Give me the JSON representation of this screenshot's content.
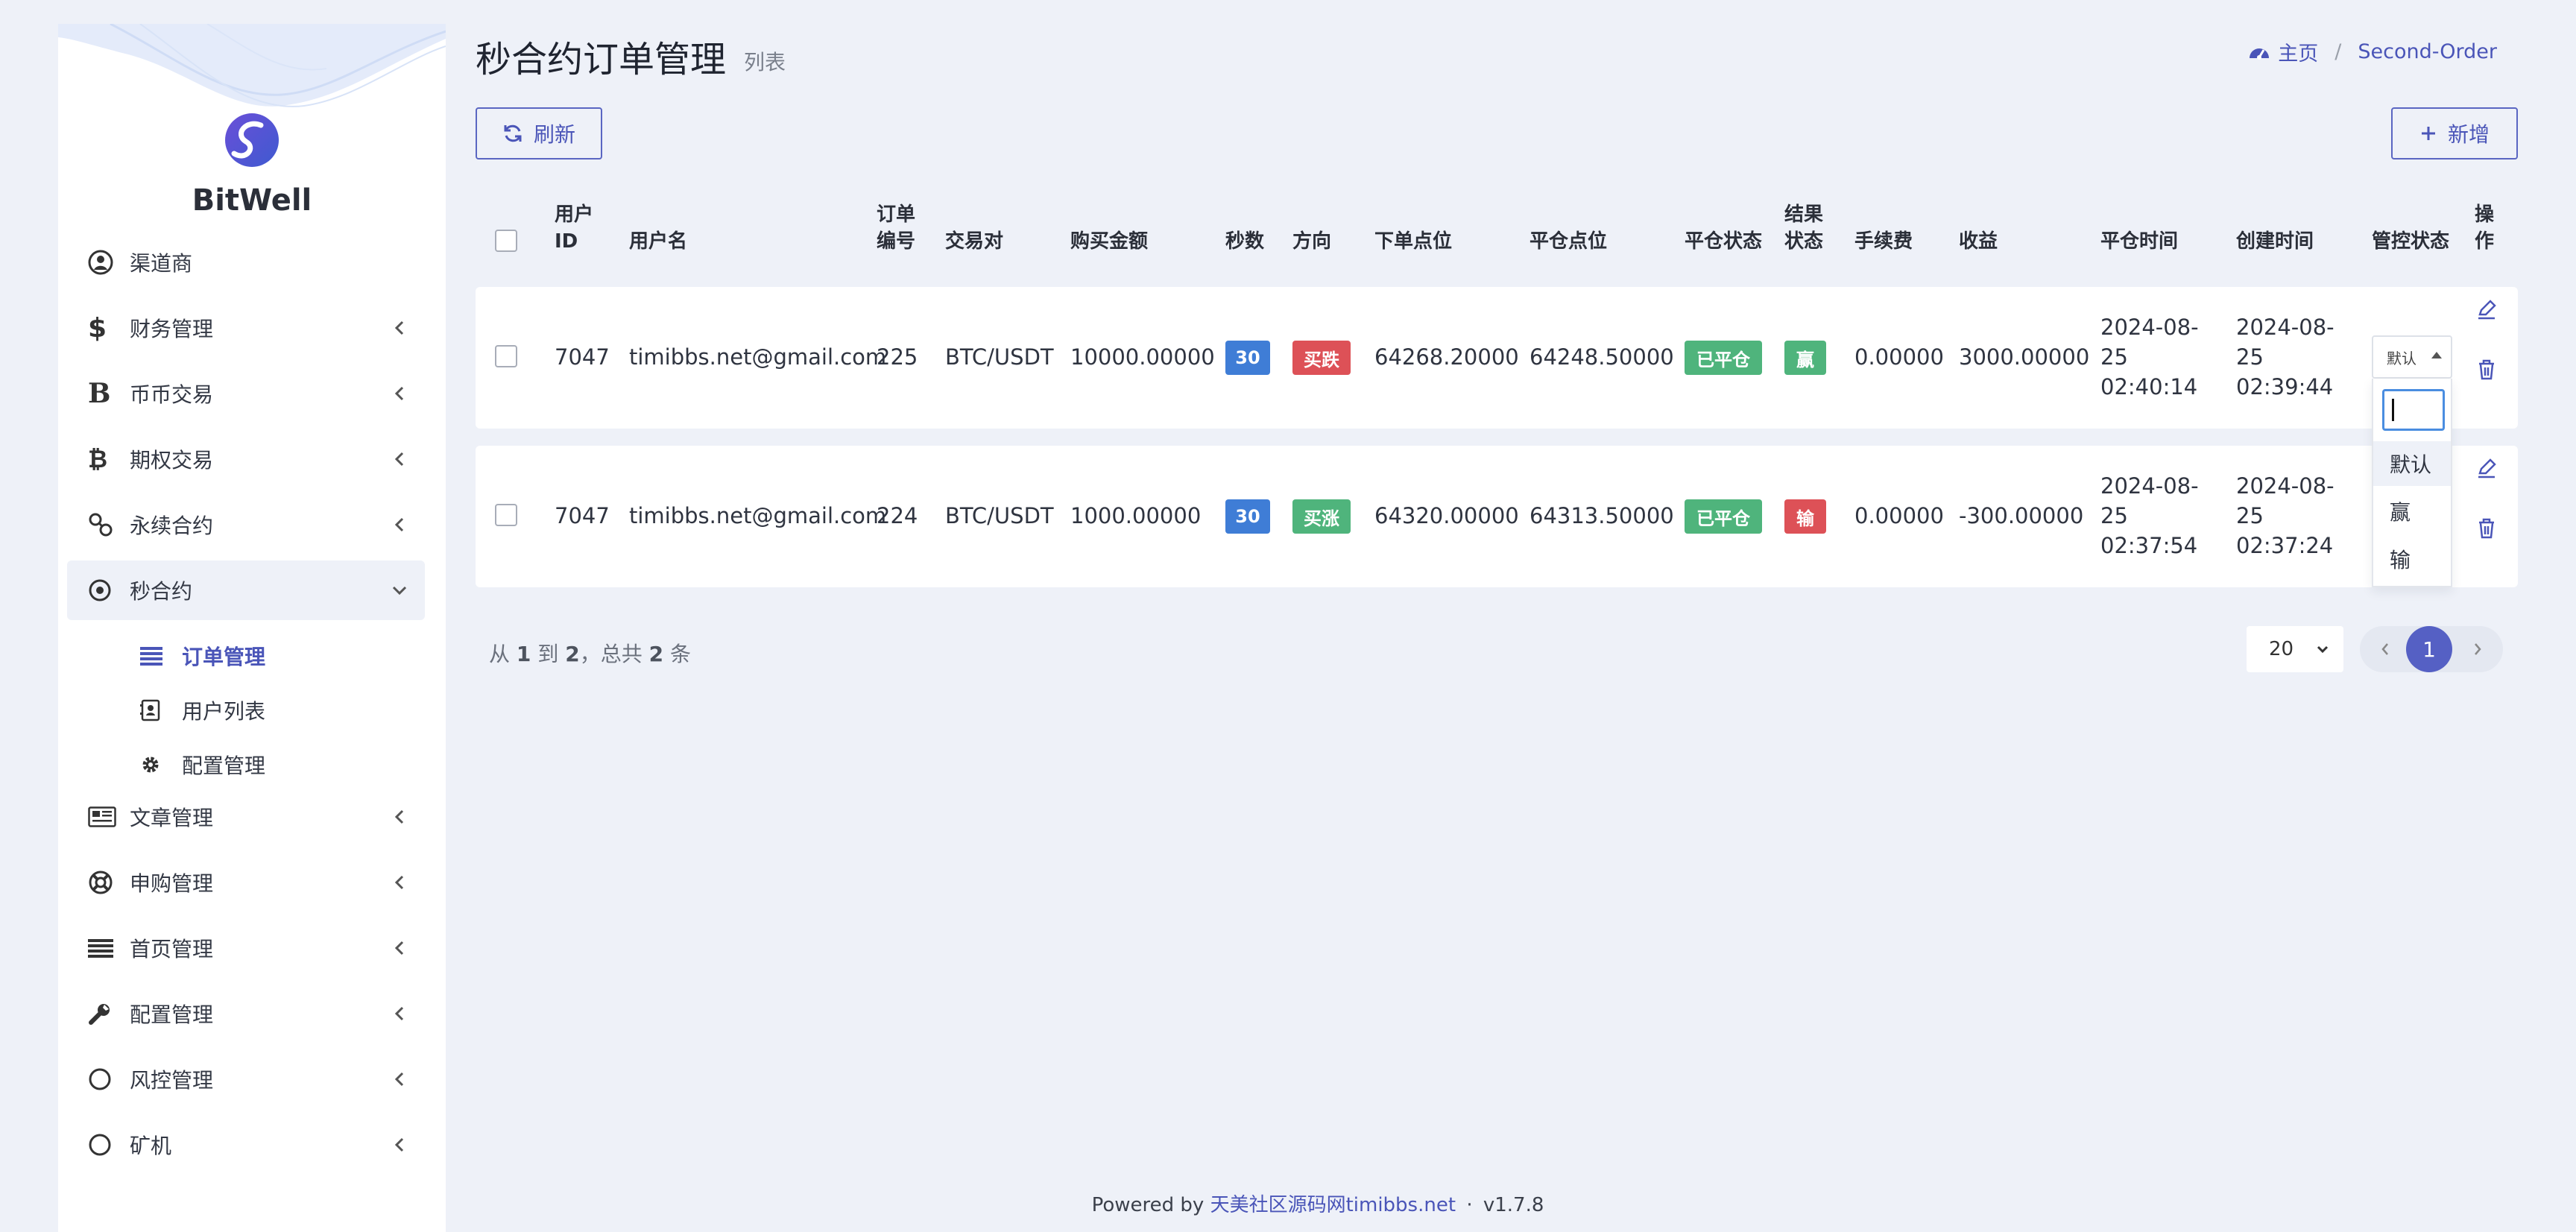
{
  "brand": {
    "name": "BitWell"
  },
  "sidebar": {
    "items": [
      {
        "label": "渠道商",
        "icon": "user-circle-icon",
        "has_children": false
      },
      {
        "label": "财务管理",
        "icon": "dollar-icon",
        "has_children": true
      },
      {
        "label": "币币交易",
        "icon": "bold-b-icon",
        "has_children": true
      },
      {
        "label": "期权交易",
        "icon": "bitcoin-icon",
        "has_children": true
      },
      {
        "label": "永续合约",
        "icon": "link-icon",
        "has_children": true
      },
      {
        "label": "秒合约",
        "icon": "dot-circle-icon",
        "has_children": true,
        "expanded": true
      },
      {
        "label": "文章管理",
        "icon": "newspaper-icon",
        "has_children": true
      },
      {
        "label": "申购管理",
        "icon": "life-ring-icon",
        "has_children": true
      },
      {
        "label": "首页管理",
        "icon": "bars-icon",
        "has_children": true
      },
      {
        "label": "配置管理",
        "icon": "wrench-icon",
        "has_children": true
      },
      {
        "label": "风控管理",
        "icon": "circle-icon",
        "has_children": true
      },
      {
        "label": "矿机",
        "icon": "circle-icon",
        "has_children": true
      }
    ],
    "subitems": [
      {
        "label": "订单管理",
        "icon": "list-icon",
        "active": true
      },
      {
        "label": "用户列表",
        "icon": "contact-icon",
        "active": false
      },
      {
        "label": "配置管理",
        "icon": "gear-icon",
        "active": false
      }
    ]
  },
  "header": {
    "title": "秒合约订单管理",
    "subtitle": "列表",
    "breadcrumb": {
      "home": "主页",
      "current": "Second-Order"
    }
  },
  "toolbar": {
    "refresh_label": "刷新",
    "add_label": "新增"
  },
  "table": {
    "columns": {
      "user_id": [
        "用户",
        "ID"
      ],
      "username": "用户名",
      "order_no": [
        "订单",
        "编号"
      ],
      "pair": "交易对",
      "amount": "购买金额",
      "seconds": "秒数",
      "direction": "方向",
      "open_price": "下单点位",
      "close_price": "平仓点位",
      "close_status": "平仓状态",
      "result_status": [
        "结果",
        "状态"
      ],
      "fee": "手续费",
      "profit": "收益",
      "close_time": "平仓时间",
      "create_time": "创建时间",
      "control_status": "管控状态",
      "ops": [
        "操",
        "作"
      ]
    },
    "rows": [
      {
        "user_id": "7047",
        "username": "timibbs.net@gmail.com",
        "order_no": "225",
        "pair": "BTC/USDT",
        "amount": "10000.00000",
        "seconds": "30",
        "direction": "买跌",
        "direction_color": "#dd5157",
        "open_price": "64268.20000",
        "close_price": "64248.50000",
        "close_status": "已平仓",
        "result": "赢",
        "result_color": "#4fb47c",
        "fee": "0.00000",
        "profit": "3000.00000",
        "close_time": [
          "2024-08-",
          "25",
          "02:40:14"
        ],
        "create_time": [
          "2024-08-",
          "25",
          "02:39:44"
        ]
      },
      {
        "user_id": "7047",
        "username": "timibbs.net@gmail.com",
        "order_no": "224",
        "pair": "BTC/USDT",
        "amount": "1000.00000",
        "seconds": "30",
        "direction": "买涨",
        "direction_color": "#4fb47c",
        "open_price": "64320.00000",
        "close_price": "64313.50000",
        "close_status": "已平仓",
        "result": "输",
        "result_color": "#dd5157",
        "fee": "0.00000",
        "profit": "-300.00000",
        "close_time": [
          "2024-08-",
          "25",
          "02:37:54"
        ],
        "create_time": [
          "2024-08-",
          "25",
          "02:37:24"
        ]
      }
    ]
  },
  "control_select": {
    "selected": "默认",
    "options": [
      "默认",
      "赢",
      "输"
    ]
  },
  "pagination": {
    "from": "1",
    "to": "2",
    "total": "2",
    "text_from": "从",
    "text_to": "到",
    "text_total": "，总共",
    "text_unit": "条",
    "per_page": "20",
    "current_page": "1"
  },
  "footer": {
    "prefix": "Powered by",
    "link": "天美社区源码网timibbs.net",
    "sep": "·",
    "version": "v1.7.8"
  },
  "colors": {
    "accent": "#4a55b8",
    "blue": "#3f7dd6",
    "red": "#dd5157",
    "green": "#4fb47c"
  }
}
